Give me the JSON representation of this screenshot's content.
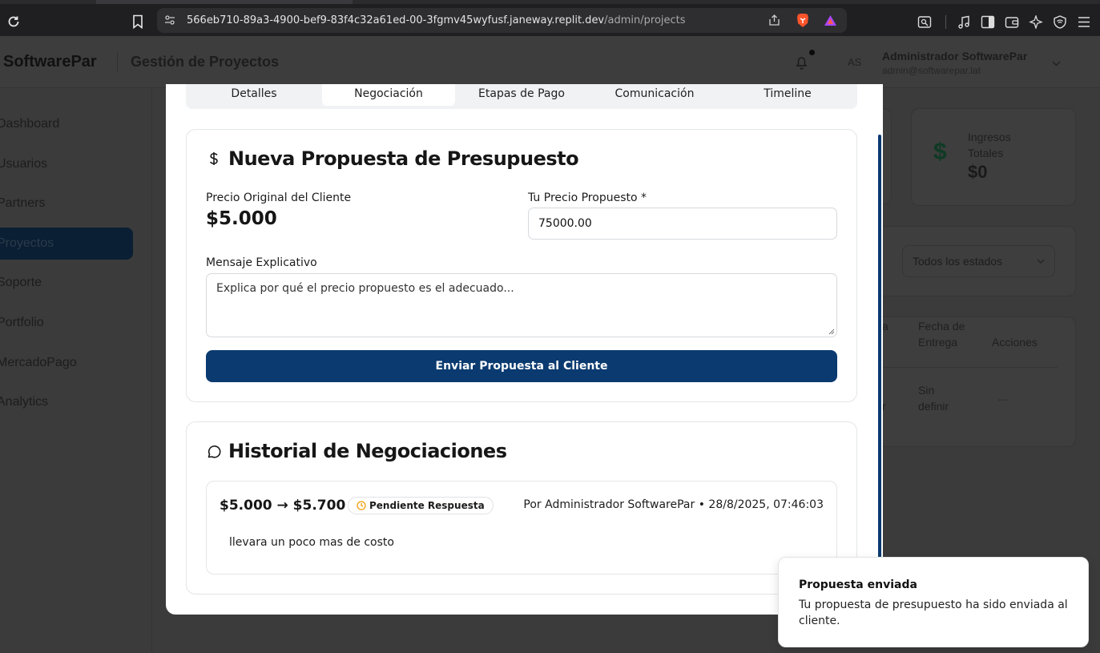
{
  "browser": {
    "url_host": "566eb710-89a3-4900-bef9-83f4c32a61ed-00-3fgmv45wyfusf.janeway.replit.dev",
    "url_path": "/admin/projects",
    "icons": [
      "reload-icon",
      "bookmark-icon",
      "site-settings-icon",
      "share-icon",
      "brave-shield-icon",
      "brave-rewards-icon",
      "reader-mode-icon",
      "music-icon",
      "sidebar-icon",
      "wallet-icon",
      "leo-ai-icon",
      "vpn-icon",
      "menu-icon"
    ]
  },
  "header": {
    "brand": "SoftwarePar",
    "page_title": "Gestión de Proyectos",
    "avatar_initials": "AS",
    "user_name": "Administrador SoftwarePar",
    "user_email": "admin@softwarepar.lat"
  },
  "sidebar": {
    "items": [
      {
        "label": "Dashboard"
      },
      {
        "label": "Usuarios"
      },
      {
        "label": "Partners"
      },
      {
        "label": "Proyectos",
        "active": true
      },
      {
        "label": "Soporte"
      },
      {
        "label": "Portfolio"
      },
      {
        "label": "MercadoPago"
      },
      {
        "label": "Analytics"
      }
    ]
  },
  "background": {
    "ingresos_label": "Ingresos Totales",
    "ingresos_value": "$0",
    "filter_status": "Todos los estados",
    "table_headers": {
      "fecha": "Fecha de Entrega",
      "acciones": "Acciones",
      "partial": "a"
    },
    "row": {
      "fecha": "Sin definir",
      "acciones": "...",
      "partial": "r"
    }
  },
  "modal": {
    "tabs": [
      {
        "label": "Detalles"
      },
      {
        "label": "Negociación",
        "active": true
      },
      {
        "label": "Etapas de Pago"
      },
      {
        "label": "Comunicación"
      },
      {
        "label": "Timeline"
      }
    ],
    "proposal": {
      "title": "Nueva Propuesta de Presupuesto",
      "original_label": "Precio Original del Cliente",
      "original_price": "$5.000",
      "proposed_label": "Tu Precio Propuesto *",
      "proposed_value": "75000.00",
      "message_label": "Mensaje Explicativo",
      "message_placeholder": "Explica por qué el precio propuesto es el adecuado...",
      "submit_label": "Enviar Propuesta al Cliente"
    },
    "history": {
      "title": "Historial de Negociaciones",
      "entries": [
        {
          "price_change": "$5.000 → $5.700",
          "status": "Pendiente Respuesta",
          "meta": "Por Administrador SoftwarePar • 28/8/2025, 07:46:03",
          "message": "llevara un poco mas de costo"
        }
      ]
    }
  },
  "toast": {
    "title": "Propuesta enviada",
    "description": "Tu propuesta de presupuesto ha sido enviada al cliente."
  },
  "colors": {
    "primary": "#0a3a70",
    "badge_icon": "#f59e0b",
    "dollar_green": "#0f3a25"
  }
}
